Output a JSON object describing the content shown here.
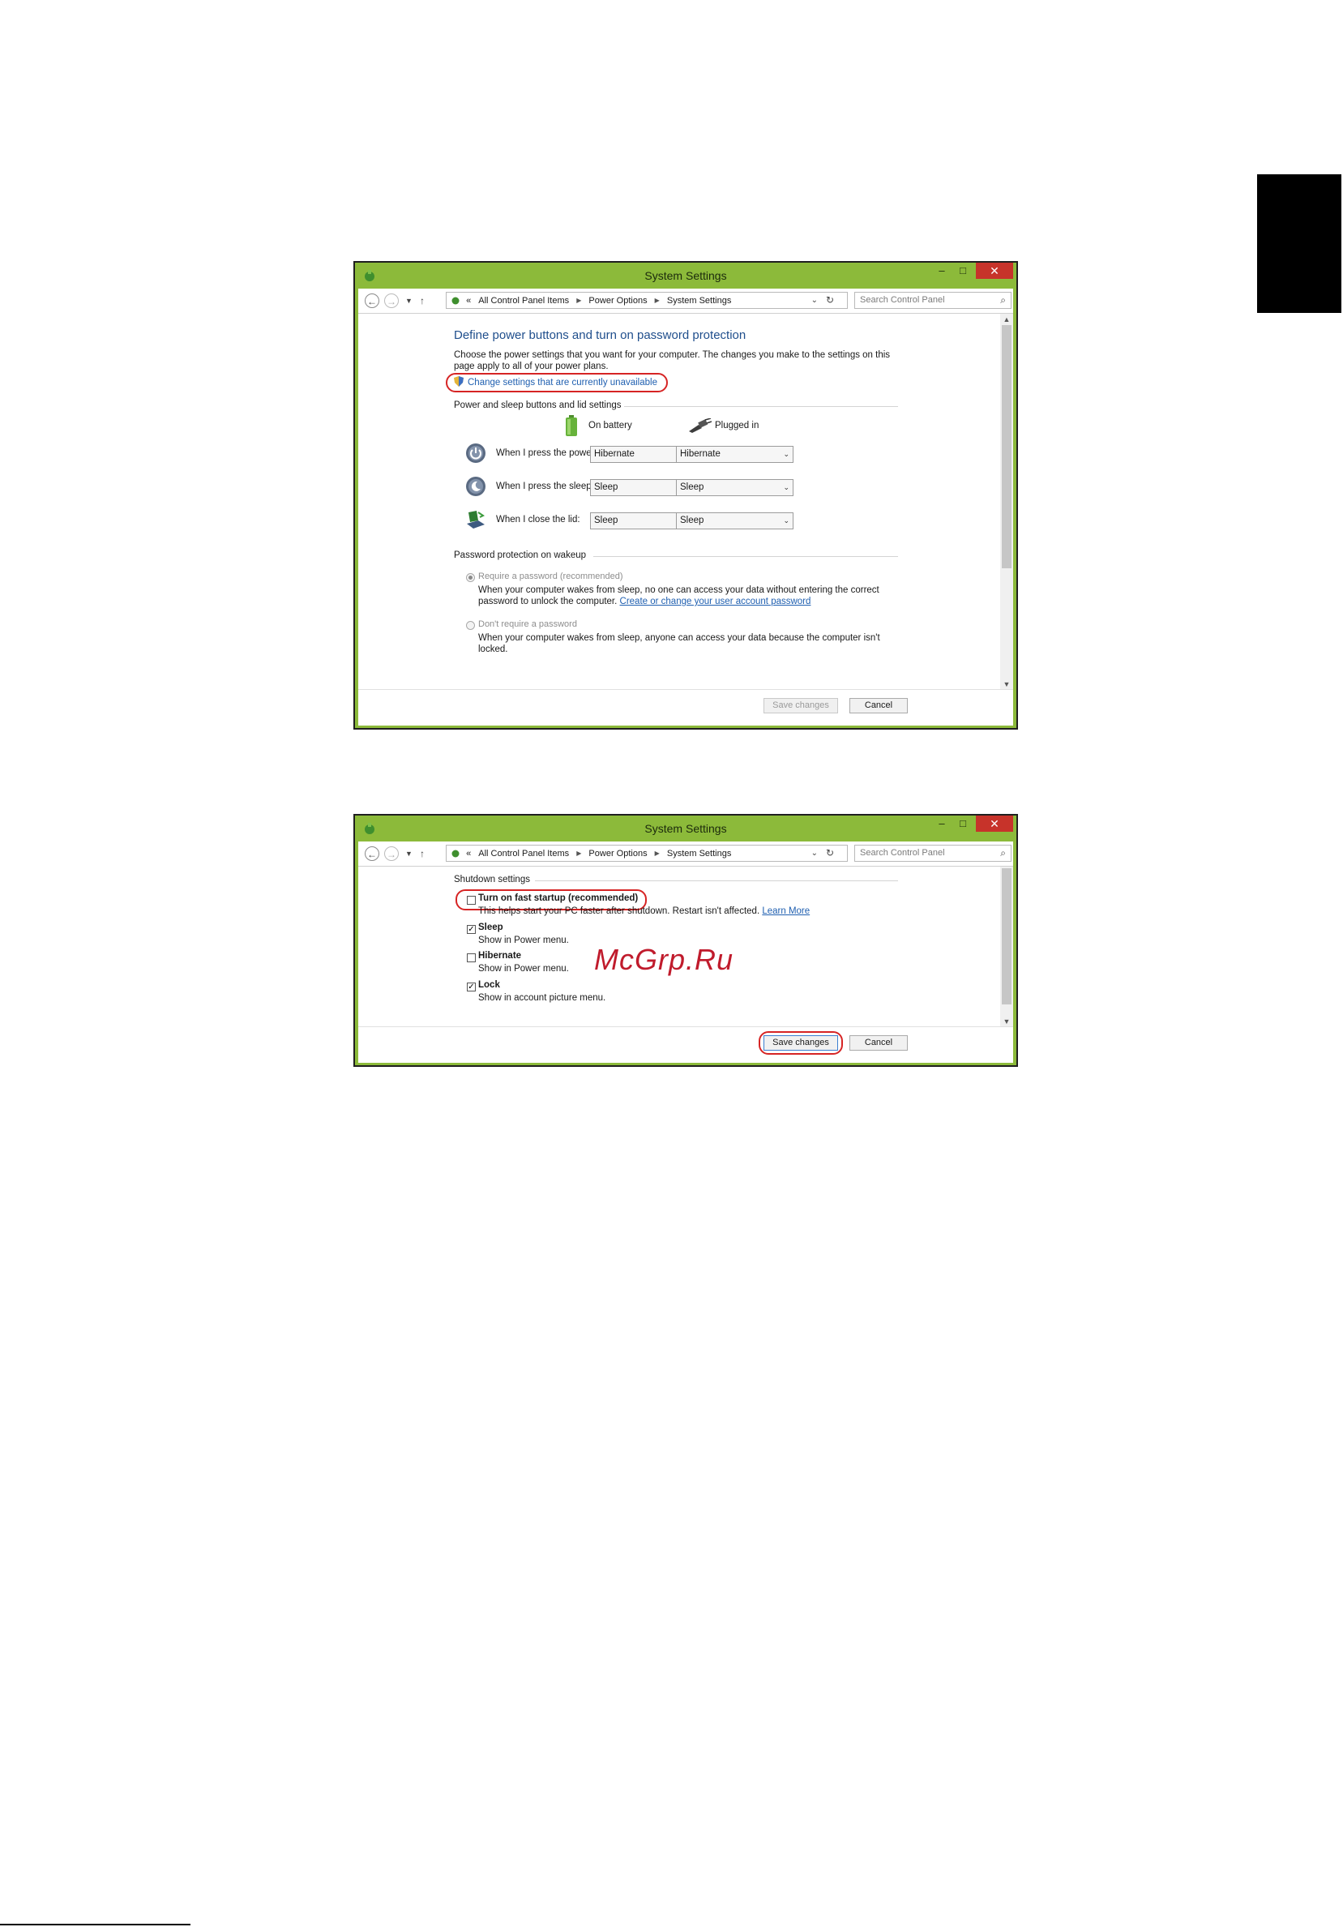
{
  "window": {
    "title": "System Settings",
    "minimize": "–",
    "maximize": "□",
    "close": "✕"
  },
  "address": {
    "prefix": "«",
    "crumbs": [
      "All Control Panel Items",
      "Power Options",
      "System Settings"
    ],
    "search_placeholder": "Search Control Panel"
  },
  "screen1": {
    "heading": "Define power buttons and turn on password protection",
    "description": "Choose the power settings that you want for your computer. The changes you make to the settings on this page apply to all of your power plans.",
    "change_link": "Change settings that are currently unavailable",
    "group1": "Power and sleep buttons and lid settings",
    "col_battery": "On battery",
    "col_plugged": "Plugged in",
    "rows": [
      {
        "label": "When I press the power button:",
        "battery": "Hibernate",
        "plugged": "Hibernate"
      },
      {
        "label": "When I press the sleep button:",
        "battery": "Sleep",
        "plugged": "Sleep"
      },
      {
        "label": "When I close the lid:",
        "battery": "Sleep",
        "plugged": "Sleep"
      }
    ],
    "group2": "Password protection on wakeup",
    "opt1_label": "Require a password (recommended)",
    "opt1_desc": "When your computer wakes from sleep, no one can access your data without entering the correct password to unlock the computer.",
    "opt1_link": "Create or change your user account password",
    "opt2_label": "Don't require a password",
    "opt2_desc": "When your computer wakes from sleep, anyone can access your data because the computer isn't locked.",
    "save": "Save changes",
    "cancel": "Cancel"
  },
  "screen2": {
    "group": "Shutdown settings",
    "items": [
      {
        "label": "Turn on fast startup (recommended)",
        "checked": false,
        "desc": "This helps start your PC faster after shutdown. Restart isn't affected.",
        "link": "Learn More"
      },
      {
        "label": "Sleep",
        "checked": true,
        "desc": "Show in Power menu."
      },
      {
        "label": "Hibernate",
        "checked": false,
        "desc": "Show in Power menu."
      },
      {
        "label": "Lock",
        "checked": true,
        "desc": "Show in account picture menu."
      }
    ],
    "save": "Save changes",
    "cancel": "Cancel"
  },
  "watermark": "McGrp.Ru",
  "check_mark": "✓",
  "colors": {
    "window_frame": "#8cba3a",
    "close_button": "#c7332a",
    "link": "#1f5fb0",
    "highlight_ring": "#d62424"
  }
}
